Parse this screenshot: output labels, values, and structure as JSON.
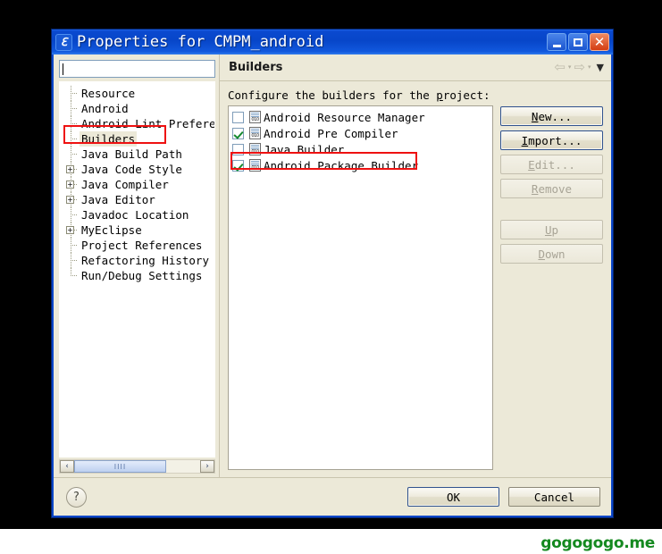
{
  "window": {
    "title": "Properties for CMPM_android",
    "icon": "properties-icon",
    "buttons": {
      "minimize": "minimize-icon",
      "maximize": "maximize-icon",
      "close": "close-icon"
    }
  },
  "sidebar": {
    "filter": {
      "value": "",
      "placeholder": ""
    },
    "items": [
      {
        "label": "Resource",
        "expandable": false,
        "selected": false
      },
      {
        "label": "Android",
        "expandable": false,
        "selected": false
      },
      {
        "label": "Android Lint Preferen",
        "expandable": false,
        "selected": false
      },
      {
        "label": "Builders",
        "expandable": false,
        "selected": true
      },
      {
        "label": "Java Build Path",
        "expandable": false,
        "selected": false
      },
      {
        "label": "Java Code Style",
        "expandable": true,
        "selected": false
      },
      {
        "label": "Java Compiler",
        "expandable": true,
        "selected": false
      },
      {
        "label": "Java Editor",
        "expandable": true,
        "selected": false
      },
      {
        "label": "Javadoc Location",
        "expandable": false,
        "selected": false
      },
      {
        "label": "MyEclipse",
        "expandable": true,
        "selected": false
      },
      {
        "label": "Project References",
        "expandable": false,
        "selected": false
      },
      {
        "label": "Refactoring History",
        "expandable": false,
        "selected": false
      },
      {
        "label": "Run/Debug Settings",
        "expandable": false,
        "selected": false
      }
    ],
    "expander_glyph": "+",
    "scrollbar": {
      "left_arrow": "‹",
      "right_arrow": "›",
      "grip": "IIII"
    }
  },
  "page": {
    "title": "Builders",
    "nav": {
      "back": "⇦",
      "forward": "⇨",
      "caret": "▾",
      "menu": "▼"
    },
    "description_pre": "Configure the builders for the ",
    "description_key": "p",
    "description_post": "roject:",
    "builders": [
      {
        "label": "Android Resource Manager",
        "checked": false,
        "highlighted": false
      },
      {
        "label": "Android Pre Compiler",
        "checked": true,
        "highlighted": false
      },
      {
        "label": "Java Builder",
        "checked": false,
        "highlighted": false
      },
      {
        "label": "Android Package Builder",
        "checked": true,
        "highlighted": true
      }
    ],
    "builder_icon_text": "010",
    "actions": [
      {
        "label_pre": "",
        "key": "N",
        "label_post": "ew...",
        "enabled": true,
        "name": "new-button"
      },
      {
        "label_pre": "",
        "key": "I",
        "label_post": "mport...",
        "enabled": true,
        "name": "import-button"
      },
      {
        "label_pre": "",
        "key": "E",
        "label_post": "dit...",
        "enabled": false,
        "name": "edit-button"
      },
      {
        "label_pre": "",
        "key": "R",
        "label_post": "emove",
        "enabled": false,
        "name": "remove-button"
      },
      {
        "label_pre": "",
        "key": "U",
        "label_post": "p",
        "enabled": false,
        "name": "up-button"
      },
      {
        "label_pre": "",
        "key": "D",
        "label_post": "own",
        "enabled": false,
        "name": "down-button"
      }
    ]
  },
  "footer": {
    "help": "?",
    "ok": "OK",
    "cancel": "Cancel"
  },
  "watermark": {
    "text": "gogogogo.me",
    "color": "#14891f"
  },
  "annotations": {
    "accent_color": "#ee1111",
    "boxes": [
      "sidebar-builders",
      "android-package-builder"
    ]
  }
}
